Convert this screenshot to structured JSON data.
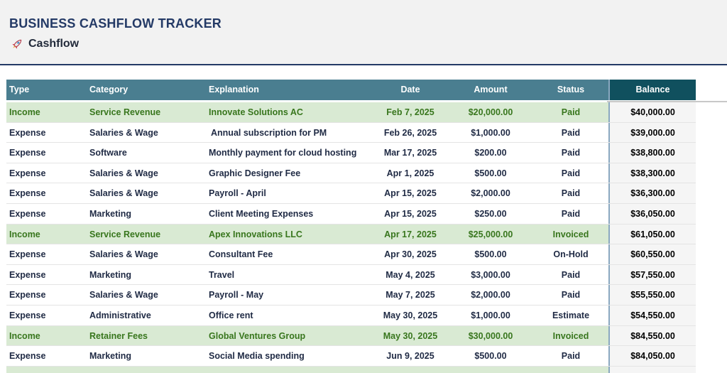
{
  "sheet": {
    "title": "BUSINESS CASHFLOW TRACKER",
    "subtitle": "Cashflow",
    "subtitle_icon": "rocket-icon"
  },
  "columns": [
    "Type",
    "Category",
    "Explanation",
    "Date",
    "Amount",
    "Status",
    "Balance"
  ],
  "rows": [
    {
      "type": "Income",
      "category": "Service Revenue",
      "explanation": "Innovate Solutions AC",
      "date": "Feb 7, 2025",
      "amount": "$20,000.00",
      "status": "Paid",
      "balance": "$40,000.00"
    },
    {
      "type": "Expense",
      "category": "Salaries & Wage",
      "explanation": " Annual subscription for PM",
      "date": "Feb 26, 2025",
      "amount": "$1,000.00",
      "status": "Paid",
      "balance": "$39,000.00"
    },
    {
      "type": "Expense",
      "category": "Software",
      "explanation": "Monthly payment for cloud hosting",
      "date": "Mar 17, 2025",
      "amount": "$200.00",
      "status": "Paid",
      "balance": "$38,800.00"
    },
    {
      "type": "Expense",
      "category": "Salaries & Wage",
      "explanation": "Graphic Designer Fee",
      "date": "Apr 1, 2025",
      "amount": "$500.00",
      "status": "Paid",
      "balance": "$38,300.00"
    },
    {
      "type": "Expense",
      "category": "Salaries & Wage",
      "explanation": "Payroll - April",
      "date": "Apr 15, 2025",
      "amount": "$2,000.00",
      "status": "Paid",
      "balance": "$36,300.00"
    },
    {
      "type": "Expense",
      "category": "Marketing",
      "explanation": "Client Meeting Expenses",
      "date": "Apr 15, 2025",
      "amount": "$250.00",
      "status": "Paid",
      "balance": "$36,050.00"
    },
    {
      "type": "Income",
      "category": "Service Revenue",
      "explanation": "Apex Innovations LLC",
      "date": "Apr 17, 2025",
      "amount": "$25,000.00",
      "status": "Invoiced",
      "balance": "$61,050.00"
    },
    {
      "type": "Expense",
      "category": "Salaries & Wage",
      "explanation": "Consultant Fee",
      "date": "Apr 30, 2025",
      "amount": "$500.00",
      "status": "On-Hold",
      "balance": "$60,550.00"
    },
    {
      "type": "Expense",
      "category": "Marketing",
      "explanation": "Travel",
      "date": "May 4, 2025",
      "amount": "$3,000.00",
      "status": "Paid",
      "balance": "$57,550.00"
    },
    {
      "type": "Expense",
      "category": "Salaries & Wage",
      "explanation": "Payroll - May",
      "date": "May 7, 2025",
      "amount": "$2,000.00",
      "status": "Paid",
      "balance": "$55,550.00"
    },
    {
      "type": "Expense",
      "category": "Administrative",
      "explanation": "Office rent",
      "date": "May 30, 2025",
      "amount": "$1,000.00",
      "status": "Estimate",
      "balance": "$54,550.00"
    },
    {
      "type": "Income",
      "category": "Retainer Fees",
      "explanation": "Global Ventures Group",
      "date": "May 30, 2025",
      "amount": "$30,000.00",
      "status": "Invoiced",
      "balance": "$84,550.00"
    },
    {
      "type": "Expense",
      "category": "Marketing",
      "explanation": "Social Media spending",
      "date": "Jun 9, 2025",
      "amount": "$500.00",
      "status": "Paid",
      "balance": "$84,050.00"
    }
  ],
  "colors": {
    "header_bg": "#4a7e90",
    "balance_header_bg": "#10505e",
    "income_row_bg": "#d9ead3",
    "income_text": "#38761d",
    "title_color": "#243a66"
  }
}
